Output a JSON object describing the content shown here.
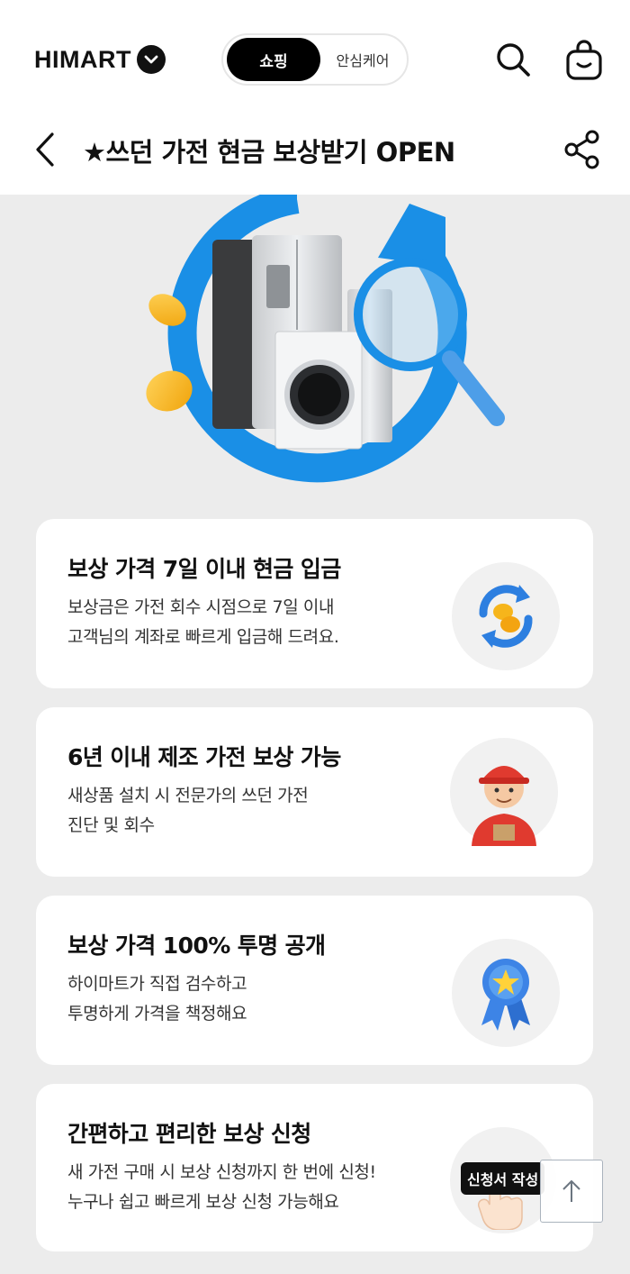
{
  "header": {
    "logo_text": "HIMART",
    "toggle": {
      "active": "쇼핑",
      "inactive": "안심케어"
    },
    "search_icon": "search-icon",
    "cart_icon": "shopping-bag-icon"
  },
  "title_bar": {
    "back_icon": "chevron-left-icon",
    "title": "★쓰던 가전 현금 보상받기 OPEN",
    "share_icon": "share-icon"
  },
  "cards": [
    {
      "title": "보상 가격 7일 이내 현금 입금",
      "desc": [
        "보상금은 가전 회수 시점으로 7일 이내",
        "고객님의 계좌로 빠르게 입금해 드려요."
      ],
      "icon": "coin-exchange-icon"
    },
    {
      "title": "6년 이내 제조 가전 보상 가능",
      "desc": [
        "새상품 설치 시 전문가의 쓰던 가전",
        "진단 및 회수"
      ],
      "icon": "delivery-man-icon"
    },
    {
      "title": "보상 가격 100% 투명 공개",
      "desc": [
        "하이마트가 직접 검수하고",
        "투명하게 가격을 책정해요"
      ],
      "icon": "award-ribbon-icon"
    },
    {
      "title": "간편하고 편리한 보상 신청",
      "desc": [
        "새 가전 구매 시 보상 신청까지 한 번에 신청!",
        "누구나 쉽고 빠르게 보상 신청 가능해요"
      ],
      "icon": "hand-tap-icon"
    }
  ],
  "apply_badge": "신청서 작성",
  "scroll_top_icon": "arrow-up-icon",
  "colors": {
    "accent_blue": "#1a8fe6",
    "black": "#000000",
    "card_bg": "#ffffff",
    "page_bg": "#ececec"
  }
}
